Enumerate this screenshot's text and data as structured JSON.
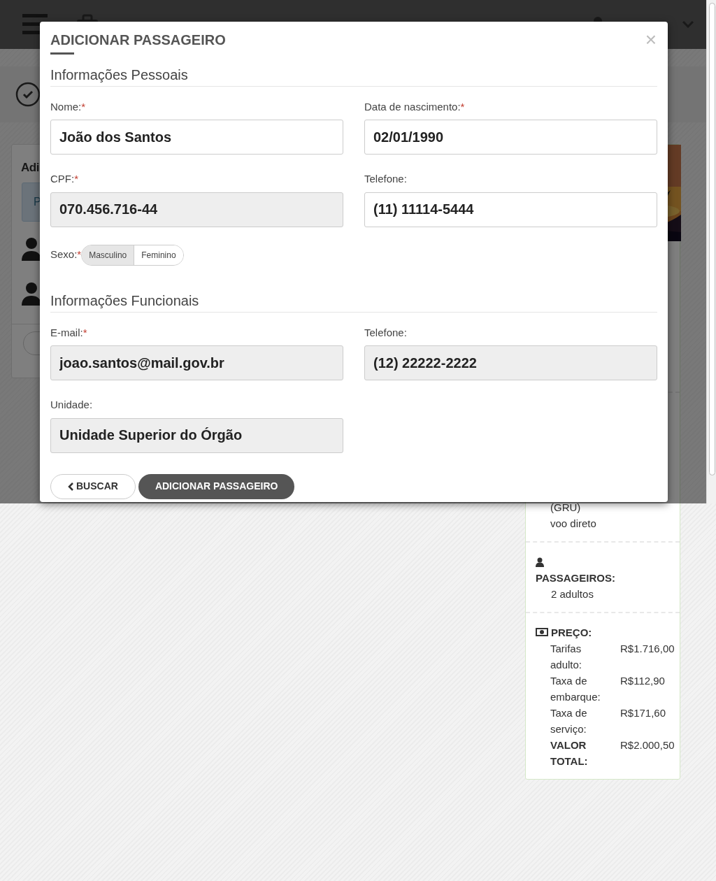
{
  "background_panel": {
    "title": "Adi",
    "tab": "P"
  },
  "modal": {
    "title": "ADICIONAR PASSAGEIRO",
    "close": "×",
    "sections": [
      {
        "title": "Informações Pessoais",
        "fields": [
          {
            "label": "Nome:",
            "required_mark": "*",
            "value": "João dos Santos",
            "disabled": false
          },
          {
            "label": "Data de nascimento:",
            "required_mark": "*",
            "value": "02/01/1990",
            "disabled": false
          },
          {
            "label": "CPF:",
            "required_mark": "*",
            "value": "070.456.716-44",
            "disabled": true
          },
          {
            "label": "Telefone:",
            "value": "(11) 11114-5444",
            "disabled": false
          }
        ],
        "gender": {
          "label": "Sexo:",
          "required_mark": "*",
          "options": [
            {
              "label": "Masculino",
              "selected": true
            },
            {
              "label": "Feminino",
              "selected": false
            }
          ]
        }
      },
      {
        "title": "Informações Funcionais",
        "fields": [
          {
            "label": "E-mail:",
            "required_mark": "*",
            "value": "joao.santos@mail.gov.br",
            "disabled": true
          },
          {
            "label": "Telefone:",
            "value": "(12) 22222-2222",
            "disabled": true
          },
          {
            "label": "Unidade:",
            "value": "Unidade Superior do Órgão",
            "disabled": true
          }
        ]
      }
    ],
    "buttons": [
      {
        "label": "BUSCAR",
        "kind": "back"
      },
      {
        "label": "ADICIONAR PASSAGEIRO",
        "kind": "primary"
      }
    ]
  },
  "summary": {
    "route_lines": [
      "(GRU)",
      "voo direto"
    ],
    "passengers": {
      "label": "PASSAGEIROS:",
      "value": "2 adultos"
    },
    "price": {
      "label": "PREÇO:",
      "rows": [
        {
          "label": "Tarifas adulto:",
          "value": "R$1.716,00",
          "bold": false
        },
        {
          "label": "Taxa de embarque:",
          "value": "R$112,90",
          "bold": false
        },
        {
          "label": "Taxa de serviço:",
          "value": "R$171,60",
          "bold": false
        },
        {
          "label": "VALOR TOTAL:",
          "value": "R$2.000,50",
          "bold": true
        }
      ]
    }
  }
}
